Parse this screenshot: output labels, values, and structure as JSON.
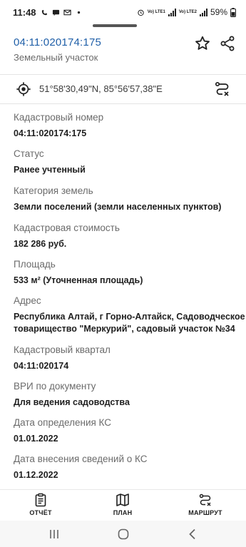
{
  "status_bar": {
    "time": "11:48",
    "network_label": "Vo) LTE1",
    "network_label_2": "Vo) LTE2",
    "battery": "59%"
  },
  "header": {
    "title": "04:11:020174:175",
    "subtitle": "Земельный участок"
  },
  "coords": {
    "text": "51°58'30,49\"N, 85°56'57,38\"E"
  },
  "fields": [
    {
      "label": "Кадастровый номер",
      "value": "04:11:020174:175"
    },
    {
      "label": "Статус",
      "value": "Ранее учтенный"
    },
    {
      "label": "Категория земель",
      "value": "Земли поселений (земли населенных пунктов)"
    },
    {
      "label": "Кадастровая стоимость",
      "value": "182 286 руб."
    },
    {
      "label": "Площадь",
      "value": "533 м² (Уточненная площадь)"
    },
    {
      "label": "Адрес",
      "value": "Республика Алтай, г Горно-Алтайск, Садоводческое товарищество \"Меркурий\", садовый участок №34"
    },
    {
      "label": "Кадастровый квартал",
      "value": "04:11:020174"
    },
    {
      "label": "ВРИ по документу",
      "value": "Для ведения садоводства"
    },
    {
      "label": "Дата определения КС",
      "value": "01.01.2022"
    },
    {
      "label": "Дата внесения сведений о КС",
      "value": "01.12.2022"
    }
  ],
  "bottom_nav": {
    "report": "ОТЧЁТ",
    "plan": "ПЛАН",
    "route": "МАРШРУТ"
  },
  "icons": {
    "accent": "#1f5fa8"
  }
}
